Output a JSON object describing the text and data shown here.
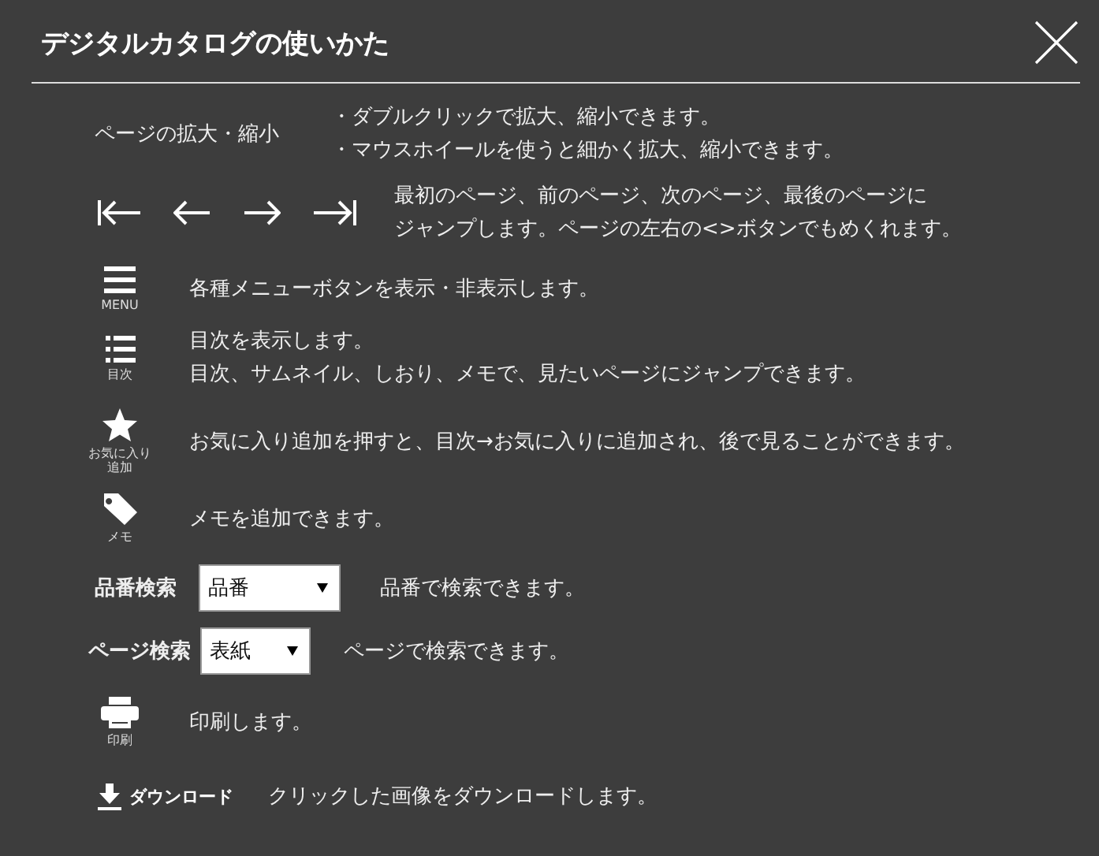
{
  "title": "デジタルカタログの使いかた",
  "rows": [
    {
      "kind": "zoom",
      "label": "ページの拡大・縮小",
      "lines": [
        "・ダブルクリックで拡大、縮小できます。",
        "・マウスホイールを使うと細かく拡大、縮小できます。"
      ]
    },
    {
      "kind": "nav",
      "lines": [
        "最初のページ、前のページ、次のページ、最後のページに",
        "ジャンプします。ページの左右の<>ボタンでもめくれます。"
      ]
    },
    {
      "kind": "menu",
      "caption": "MENU",
      "lines": [
        "各種メニューボタンを表示・非表示します。"
      ]
    },
    {
      "kind": "toc",
      "caption": "目次",
      "lines": [
        "目次を表示します。",
        "目次、サムネイル、しおり、メモで、見たいページにジャンプできます。"
      ]
    },
    {
      "kind": "favorite",
      "caption": "お気に入り追加",
      "lines": [
        "お気に入り追加を押すと、目次→お気に入りに追加され、後で見ることができます。"
      ]
    },
    {
      "kind": "memo",
      "caption": "メモ",
      "lines": [
        "メモを追加できます。"
      ]
    },
    {
      "kind": "select",
      "label": "品番検索",
      "value": "品番",
      "lines": [
        "品番で検索できます。"
      ]
    },
    {
      "kind": "select",
      "label": "ページ検索",
      "value": "表紙",
      "lines": [
        "ページで検索できます。"
      ]
    },
    {
      "kind": "print",
      "caption": "印刷",
      "lines": [
        "印刷します。"
      ]
    },
    {
      "kind": "download",
      "label": "ダウンロード",
      "lines": [
        "クリックした画像をダウンロードします。"
      ]
    }
  ]
}
